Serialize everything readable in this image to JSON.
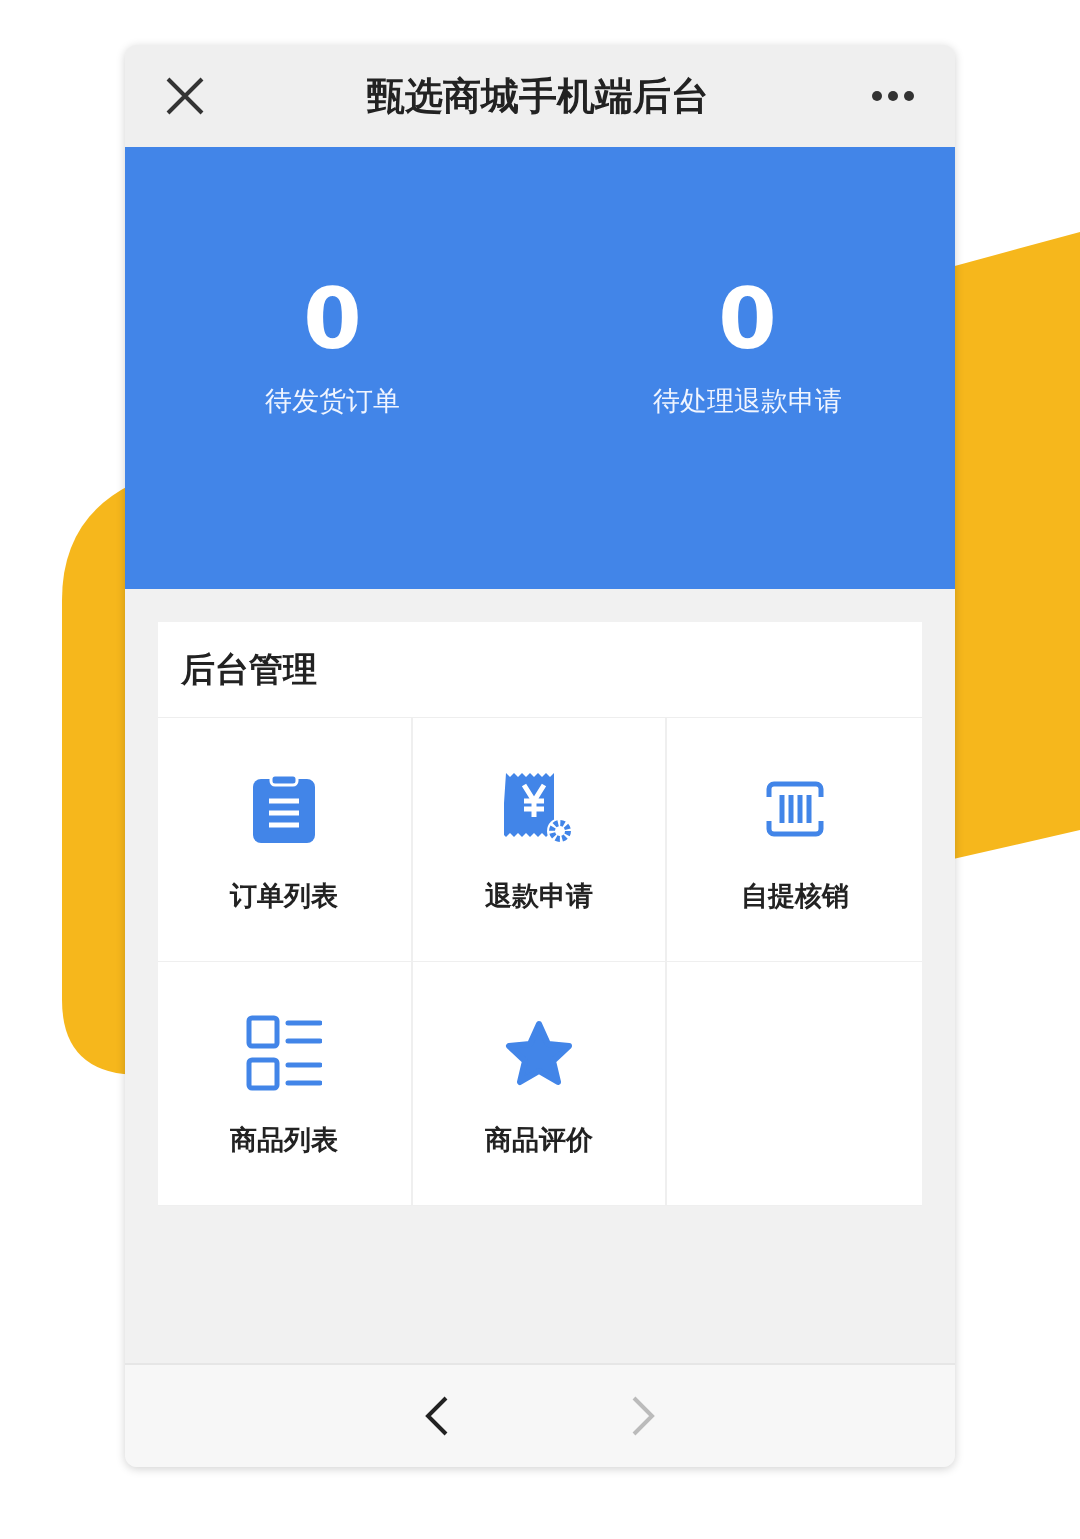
{
  "window": {
    "title": "甄选商城手机端后台"
  },
  "stats": [
    {
      "value": "0",
      "label": "待发货订单"
    },
    {
      "value": "0",
      "label": "待处理退款申请"
    }
  ],
  "panel": {
    "title": "后台管理",
    "items": [
      {
        "label": "订单列表",
        "kind": "clipboard"
      },
      {
        "label": "退款申请",
        "kind": "receipt"
      },
      {
        "label": "自提核销",
        "kind": "scan"
      },
      {
        "label": "商品列表",
        "kind": "list"
      },
      {
        "label": "商品评价",
        "kind": "star"
      }
    ]
  },
  "nav": {
    "back": {
      "disabled": false
    },
    "forward": {
      "disabled": true
    }
  }
}
